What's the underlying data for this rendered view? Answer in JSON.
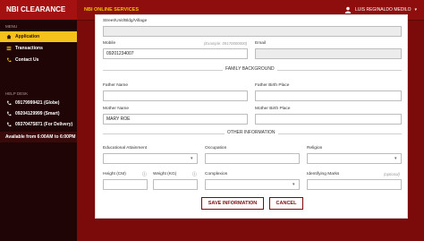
{
  "header": {
    "brand": "NBI CLEARANCE",
    "title": "NBI ONLINE SERVICES",
    "user_name": "LUIS REGINALDO MEDILO"
  },
  "sidebar": {
    "menu_label": "MENU",
    "items": [
      {
        "label": "Application",
        "icon": "home-icon",
        "active": true
      },
      {
        "label": "Transactions",
        "icon": "list-icon",
        "active": false
      },
      {
        "label": "Contact Us",
        "icon": "phone-icon",
        "active": false
      }
    ],
    "help_label": "HELP DESK",
    "help_items": [
      {
        "label": "09179999421 (Globe)",
        "icon": "phone-icon"
      },
      {
        "label": "09204129999 (Smart)",
        "icon": "phone-icon"
      },
      {
        "label": "09370475871 (For Delivery)",
        "icon": "phone-icon"
      }
    ],
    "availability": "Available from 6:00AM to 6:00PM"
  },
  "form": {
    "street_label": "Street/Unit/Bldg/Village",
    "street_value": "",
    "mobile_label": "Mobile",
    "mobile_hint": "(Example: 09170000000)",
    "mobile_value": "09201234007",
    "email_label": "Email",
    "email_value": "",
    "family_section": "FAMILY BACKGROUND",
    "father_name_label": "Father Name",
    "father_name_value": "",
    "father_birth_label": "Father Birth Place",
    "father_birth_value": "",
    "mother_name_label": "Mother Name",
    "mother_name_value": "MARY ROE",
    "mother_birth_label": "Mother Birth Place",
    "mother_birth_value": "",
    "other_section": "OTHER INFORMATION",
    "education_label": "Educational Attainment",
    "education_value": "",
    "occupation_label": "Occupation",
    "occupation_value": "",
    "religion_label": "Religion",
    "religion_value": "",
    "height_label": "Height (CM)",
    "height_value": "",
    "weight_label": "Weight (KG)",
    "weight_value": "",
    "complexion_label": "Complexion",
    "complexion_value": "",
    "marks_label": "Identifying Marks",
    "marks_hint": "(optional)",
    "marks_value": ""
  },
  "buttons": {
    "save": "SAVE INFORMATION",
    "cancel": "CANCEL"
  },
  "colors": {
    "primary": "#7b0b0b",
    "accent": "#f4c21b",
    "sidebar": "#1f0505"
  }
}
